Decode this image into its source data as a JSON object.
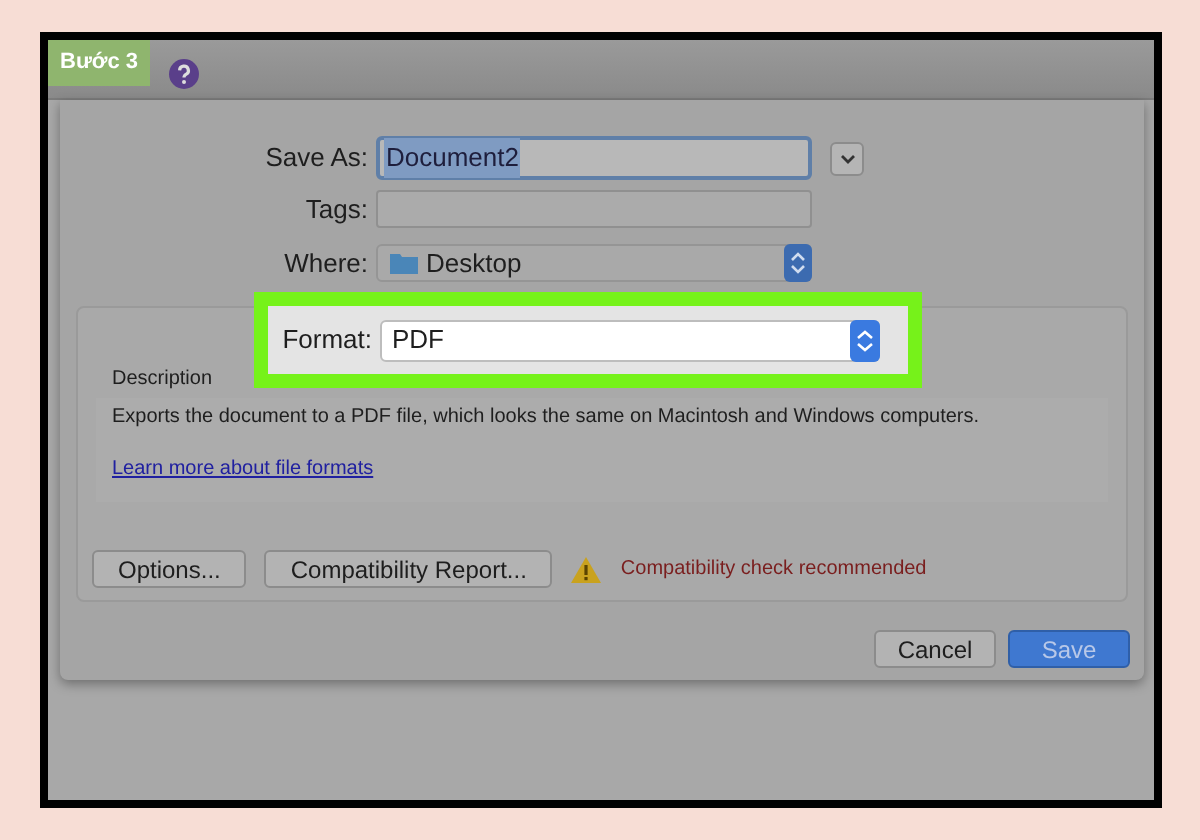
{
  "step_badge": "Bước 3",
  "save_dialog": {
    "save_as": {
      "label": "Save As:",
      "value": "Document2",
      "value_selected": true
    },
    "tags": {
      "label": "Tags:"
    },
    "where": {
      "label": "Where:",
      "value": "Desktop"
    },
    "format": {
      "label": "Format:",
      "value": "PDF",
      "highlighted": true
    },
    "description_label": "Description",
    "description": "Exports the document to a PDF file, which looks the same on Macintosh and Windows computers.",
    "link": "Learn more about file formats",
    "option_buttons": [
      "Options...",
      "Compatibility Report..."
    ],
    "warning": "Compatibility check recommended",
    "buttons": [
      {
        "label": "Cancel",
        "default": false
      },
      {
        "label": "Save",
        "default": true
      }
    ]
  }
}
